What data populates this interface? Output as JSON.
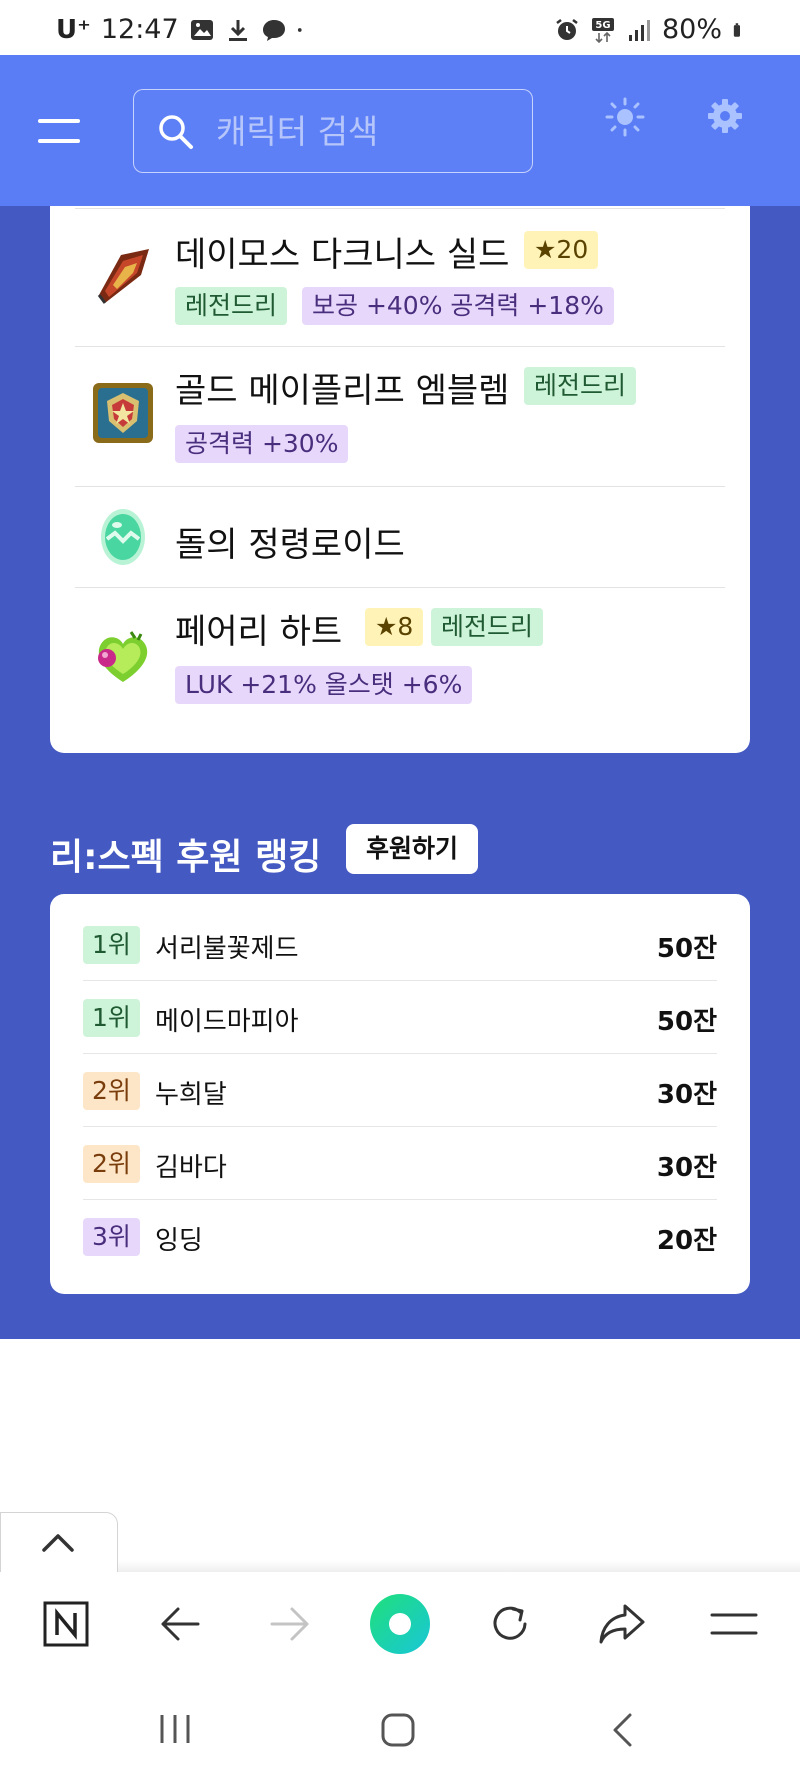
{
  "status_bar": {
    "carrier": "U⁺",
    "time": "12:47",
    "network": "5G",
    "battery": "80%"
  },
  "header": {
    "search_placeholder": "캐릭터 검색"
  },
  "equipment": [
    {
      "name": "데이모스 다크니스 실드",
      "star": "20",
      "grade": "",
      "stats": "보공 +40% 공격력 +18%",
      "first_row_grade": false,
      "second_row_grade": "레전드리"
    },
    {
      "name": "골드 메이플리프 엠블렘",
      "star": "",
      "grade": "레전드리",
      "stats": "공격력 +30%"
    },
    {
      "name": "돌의 정령로이드",
      "star": "",
      "grade": "",
      "stats": ""
    },
    {
      "name": "페어리 하트",
      "star": "8",
      "grade": "레전드리",
      "stats": "LUK +21% 올스탯 +6%"
    }
  ],
  "ranking": {
    "title": "리:스펙 후원 랭킹",
    "donate_label": "후원하기",
    "rows": [
      {
        "rank": "1위",
        "name": "서리불꽃제드",
        "count": "50잔",
        "tier": "r1"
      },
      {
        "rank": "1위",
        "name": "메이드마피아",
        "count": "50잔",
        "tier": "r1"
      },
      {
        "rank": "2위",
        "name": "누희달",
        "count": "30잔",
        "tier": "r2"
      },
      {
        "rank": "2위",
        "name": "김바다",
        "count": "30잔",
        "tier": "r2"
      },
      {
        "rank": "3위",
        "name": "잉딩",
        "count": "20잔",
        "tier": "r3"
      }
    ]
  },
  "colors": {
    "header_bg": "#5a7cf5",
    "main_bg": "#4459c2",
    "grade_legendary": "#cdf3d8",
    "star_badge": "#fff3b8",
    "stat_badge": "#e7d8fb"
  },
  "icons": {
    "menu": "hamburger-icon",
    "search": "search-icon",
    "theme": "sun-icon",
    "settings": "gear-icon",
    "toolbar": [
      "naver-home-icon",
      "back-arrow-icon",
      "forward-arrow-icon",
      "green-ball-icon",
      "refresh-icon",
      "share-icon",
      "menu-lines-icon"
    ],
    "system_nav": [
      "recent-apps-icon",
      "home-icon",
      "back-icon"
    ]
  }
}
